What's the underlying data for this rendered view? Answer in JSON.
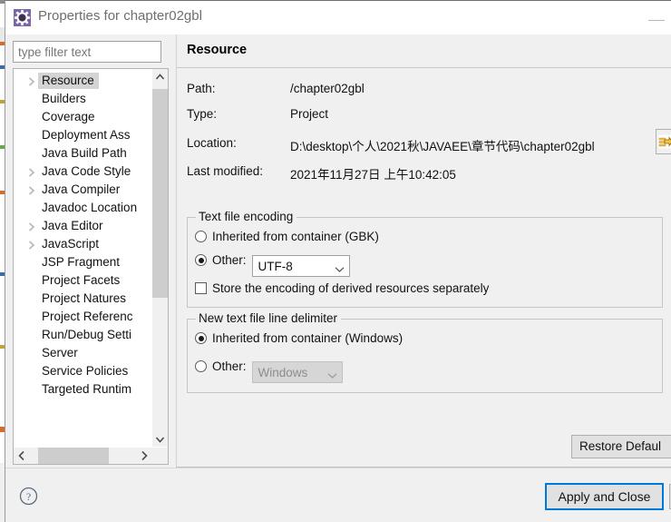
{
  "window": {
    "title": "Properties for chapter02gbl",
    "icon": "properties-gear-icon",
    "minimize_label": "—"
  },
  "filter": {
    "placeholder": "type filter text",
    "value": ""
  },
  "tree": {
    "selected": "Resource",
    "items": [
      {
        "label": "Resource",
        "expandable": true,
        "selected": true
      },
      {
        "label": "Builders",
        "expandable": false,
        "selected": false
      },
      {
        "label": "Coverage",
        "expandable": false,
        "selected": false
      },
      {
        "label": "Deployment Ass",
        "expandable": false,
        "selected": false
      },
      {
        "label": "Java Build Path",
        "expandable": false,
        "selected": false
      },
      {
        "label": "Java Code Style",
        "expandable": true,
        "selected": false
      },
      {
        "label": "Java Compiler",
        "expandable": true,
        "selected": false
      },
      {
        "label": "Javadoc Location",
        "expandable": false,
        "selected": false
      },
      {
        "label": "Java Editor",
        "expandable": true,
        "selected": false
      },
      {
        "label": "JavaScript",
        "expandable": true,
        "selected": false
      },
      {
        "label": "JSP Fragment",
        "expandable": false,
        "selected": false
      },
      {
        "label": "Project Facets",
        "expandable": false,
        "selected": false
      },
      {
        "label": "Project Natures",
        "expandable": false,
        "selected": false
      },
      {
        "label": "Project Referenc",
        "expandable": false,
        "selected": false
      },
      {
        "label": "Run/Debug Setti",
        "expandable": false,
        "selected": false
      },
      {
        "label": "Server",
        "expandable": false,
        "selected": false
      },
      {
        "label": "Service Policies",
        "expandable": false,
        "selected": false
      },
      {
        "label": "Targeted Runtim",
        "expandable": false,
        "selected": false
      }
    ],
    "scroll_up_icon": "chevron-up-icon",
    "scroll_down_icon": "chevron-down-icon",
    "scroll_left_icon": "chevron-left-icon",
    "scroll_right_icon": "chevron-right-icon"
  },
  "page": {
    "title": "Resource",
    "info": {
      "path_label": "Path:",
      "path_value": "/chapter02gbl",
      "type_label": "Type:",
      "type_value": "Project",
      "location_label": "Location:",
      "location_value": "D:\\desktop\\个人\\2021秋\\JAVAEE\\章节代码\\chapter02gbl",
      "browse_icon": "open-location-arrow-icon",
      "modified_label": "Last modified:",
      "modified_value": "2021年11月27日 上午10:42:05"
    },
    "encoding_group": {
      "title": "Text file encoding",
      "inherited_label": "Inherited from container (GBK)",
      "inherited_selected": false,
      "other_label": "Other:",
      "other_selected": true,
      "other_value": "UTF-8",
      "store_derived_label": "Store the encoding of derived resources separately",
      "store_derived_checked": false
    },
    "delimiter_group": {
      "title": "New text file line delimiter",
      "inherited_label": "Inherited from container (Windows)",
      "inherited_selected": true,
      "other_label": "Other:",
      "other_selected": false,
      "other_value": "Windows",
      "other_disabled": true
    }
  },
  "footer": {
    "restore_defaults_label": "Restore Defaul",
    "help_icon": "help-question-icon",
    "apply_and_close_label": "Apply and Close",
    "cancel_label": ""
  },
  "colors": {
    "dialog_bg": "#f0f0f0",
    "focus_border": "#0078d7",
    "selection_bg": "#d4d4d4",
    "title_text": "#6e6e6e"
  }
}
